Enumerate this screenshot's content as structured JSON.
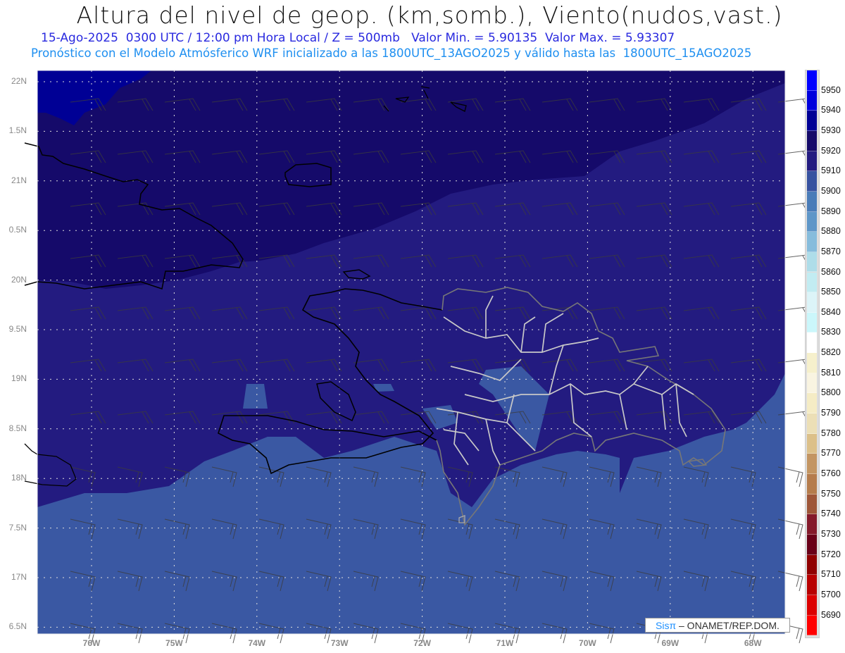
{
  "header": {
    "title": "Altura del nivel de geop. (km,somb.), Viento(nudos,vast.)",
    "subtitle1": "15-Ago-2025  0300 UTC / 12:00 pm Hora Local / Z = 500mb   Valor Min. = 5.90135  Valor Max. = 5.93307",
    "subtitle2": "Pronóstico con el Modelo Atmósferico WRF inicializado a las 1800UTC_13AGO2025 y válido hasta las  1800UTC_15AGO2025"
  },
  "axes": {
    "lat_labels": [
      "22N",
      "1.5N",
      "21N",
      "0.5N",
      "20N",
      "9.5N",
      "19N",
      "8.5N",
      "18N",
      "7.5N",
      "17N",
      "6.5N"
    ],
    "lon_labels": [
      "76W",
      "75W",
      "74W",
      "73W",
      "72W",
      "71W",
      "70W",
      "69W",
      "68W"
    ]
  },
  "colorbar": {
    "labels": [
      "5950",
      "5940",
      "5930",
      "5920",
      "5910",
      "5900",
      "5890",
      "5880",
      "5870",
      "5860",
      "5850",
      "5840",
      "5830",
      "5820",
      "5810",
      "5800",
      "5790",
      "5780",
      "5770",
      "5760",
      "5750",
      "5740",
      "5730",
      "5720",
      "5710",
      "5700",
      "5690"
    ],
    "colors": [
      "#0000ff",
      "#0000dd",
      "#000095",
      "#150a6a",
      "#231b80",
      "#3752a0",
      "#4a7cb8",
      "#5e96c8",
      "#86bcdc",
      "#aedde9",
      "#c2ecf2",
      "#dcf4f8",
      "#cbf7fb",
      "#ffffff",
      "#f6f0cc",
      "#f9f4e1",
      "#f5ecc5",
      "#ecdfb6",
      "#dcc089",
      "#c39562",
      "#b57c4c",
      "#9e5638",
      "#84192a",
      "#6a0018",
      "#900000",
      "#b80000",
      "#dc0000",
      "#ff0000"
    ]
  },
  "field_colors": {
    "z5930_5940": "#000095",
    "z5920_5930": "#150a6a",
    "z5910_5920": "#231b80",
    "z5900_5910": "#3a58a3"
  },
  "logo": {
    "brand": "Sisπ",
    "text": "– ONAMET/REP.DOM."
  }
}
